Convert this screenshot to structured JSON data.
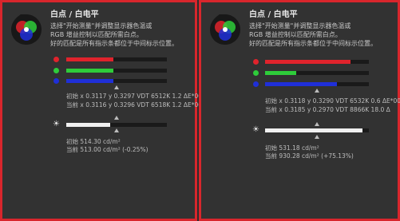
{
  "colors": {
    "border": "#d8262c",
    "red": "#e0232c",
    "green": "#2ecc3a",
    "blue": "#1f2fd8",
    "white": "#f0f0f0",
    "track": "#1a1a1a"
  },
  "panels": [
    {
      "title": "白点 / 白电平",
      "desc": [
        "选择\"开始测量\"并调整显示器色温或",
        "RGB 增益控制以匹配所需白点。",
        "好的匹配是所有指示条都位于中间标示位置。"
      ],
      "bars": {
        "red": 0.47,
        "green": 0.47,
        "blue": 0.47,
        "brightness": 0.44
      },
      "icons": {
        "logo": "rgb-circles-logo",
        "brightness": "sun-icon"
      },
      "whitepoint": {
        "initial": "初始 x 0.3117 y 0.3297 VDT 6512K 1.2 ΔE*00",
        "current": "当前 x 0.3116 y 0.3296 VDT 6518K 1.2 ΔE*00"
      },
      "luminance": {
        "initial": "初始 514.30 cd/m²",
        "current": "当前 513.00 cd/m² (-0.25%)"
      }
    },
    {
      "title": "白点 / 白电平",
      "desc": [
        "选择\"开始测量\"并调整显示器色温或",
        "RGB 增益控制以匹配所需白点。",
        "好的匹配是所有指示条都位于中间标示位置。"
      ],
      "bars": {
        "red": 0.82,
        "green": 0.3,
        "blue": 0.69,
        "brightness": 0.94
      },
      "icons": {
        "logo": "rgb-circles-logo",
        "brightness": "sun-icon"
      },
      "whitepoint": {
        "initial": "初始 x 0.3118 y 0.3290 VDT 6532K 0.6 ΔE*00",
        "current": "当前 x 0.3185 y 0.2970 VDT 8866K 18.0 Δ"
      },
      "luminance": {
        "initial": "初始 531.18 cd/m²",
        "current": "当前 930.28 cd/m² (+75.13%)"
      }
    }
  ]
}
